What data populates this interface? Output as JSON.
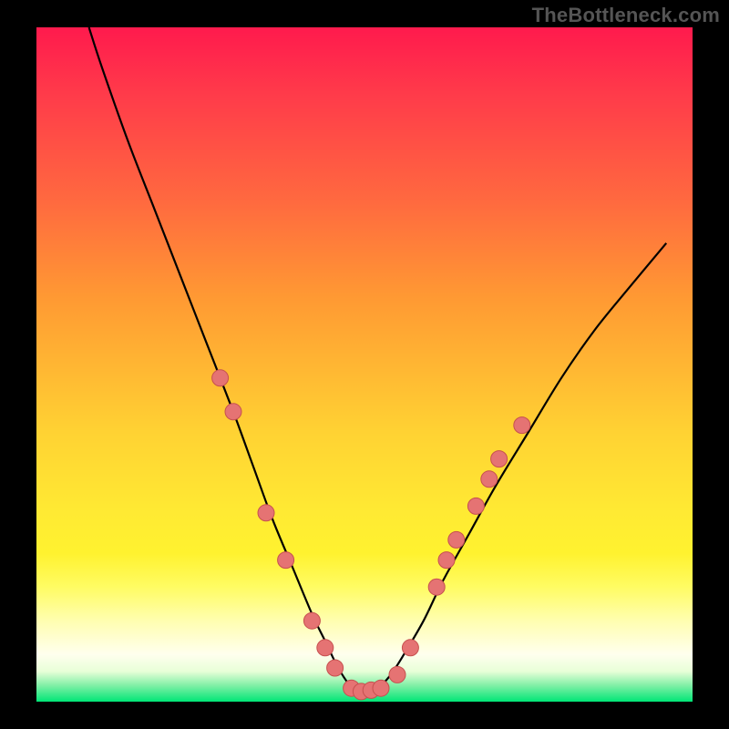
{
  "watermark": "TheBottleneck.com",
  "colors": {
    "frame": "#000000",
    "gradient_top": "#ff1a4d",
    "gradient_bottom": "#00e676",
    "curve": "#000000",
    "dot_fill": "#e57373",
    "dot_stroke": "#c6504f"
  },
  "chart_data": {
    "type": "line",
    "title": "",
    "xlabel": "",
    "ylabel": "",
    "xlim": [
      0,
      100
    ],
    "ylim": [
      0,
      100
    ],
    "series": [
      {
        "name": "bottleneck-curve",
        "x": [
          8,
          10,
          14,
          18,
          22,
          26,
          30,
          33,
          36,
          39,
          42,
          44,
          46,
          48,
          50,
          52,
          54,
          56,
          59,
          62,
          66,
          70,
          75,
          80,
          85,
          90,
          96
        ],
        "y": [
          100,
          94,
          83,
          73,
          63,
          53,
          43,
          35,
          27,
          20,
          13,
          9,
          5,
          2.2,
          1.5,
          2,
          4,
          7,
          12,
          18,
          25,
          32,
          40,
          48,
          55,
          61,
          68
        ]
      }
    ],
    "markers": [
      {
        "x": 28,
        "y": 48
      },
      {
        "x": 30,
        "y": 43
      },
      {
        "x": 35,
        "y": 28
      },
      {
        "x": 38,
        "y": 21
      },
      {
        "x": 42,
        "y": 12
      },
      {
        "x": 44,
        "y": 8
      },
      {
        "x": 45.5,
        "y": 5
      },
      {
        "x": 48,
        "y": 2
      },
      {
        "x": 49.5,
        "y": 1.5
      },
      {
        "x": 51,
        "y": 1.7
      },
      {
        "x": 52.5,
        "y": 2
      },
      {
        "x": 55,
        "y": 4
      },
      {
        "x": 57,
        "y": 8
      },
      {
        "x": 61,
        "y": 17
      },
      {
        "x": 62.5,
        "y": 21
      },
      {
        "x": 64,
        "y": 24
      },
      {
        "x": 67,
        "y": 29
      },
      {
        "x": 69,
        "y": 33
      },
      {
        "x": 70.5,
        "y": 36
      },
      {
        "x": 74,
        "y": 41
      }
    ],
    "annotations": []
  }
}
